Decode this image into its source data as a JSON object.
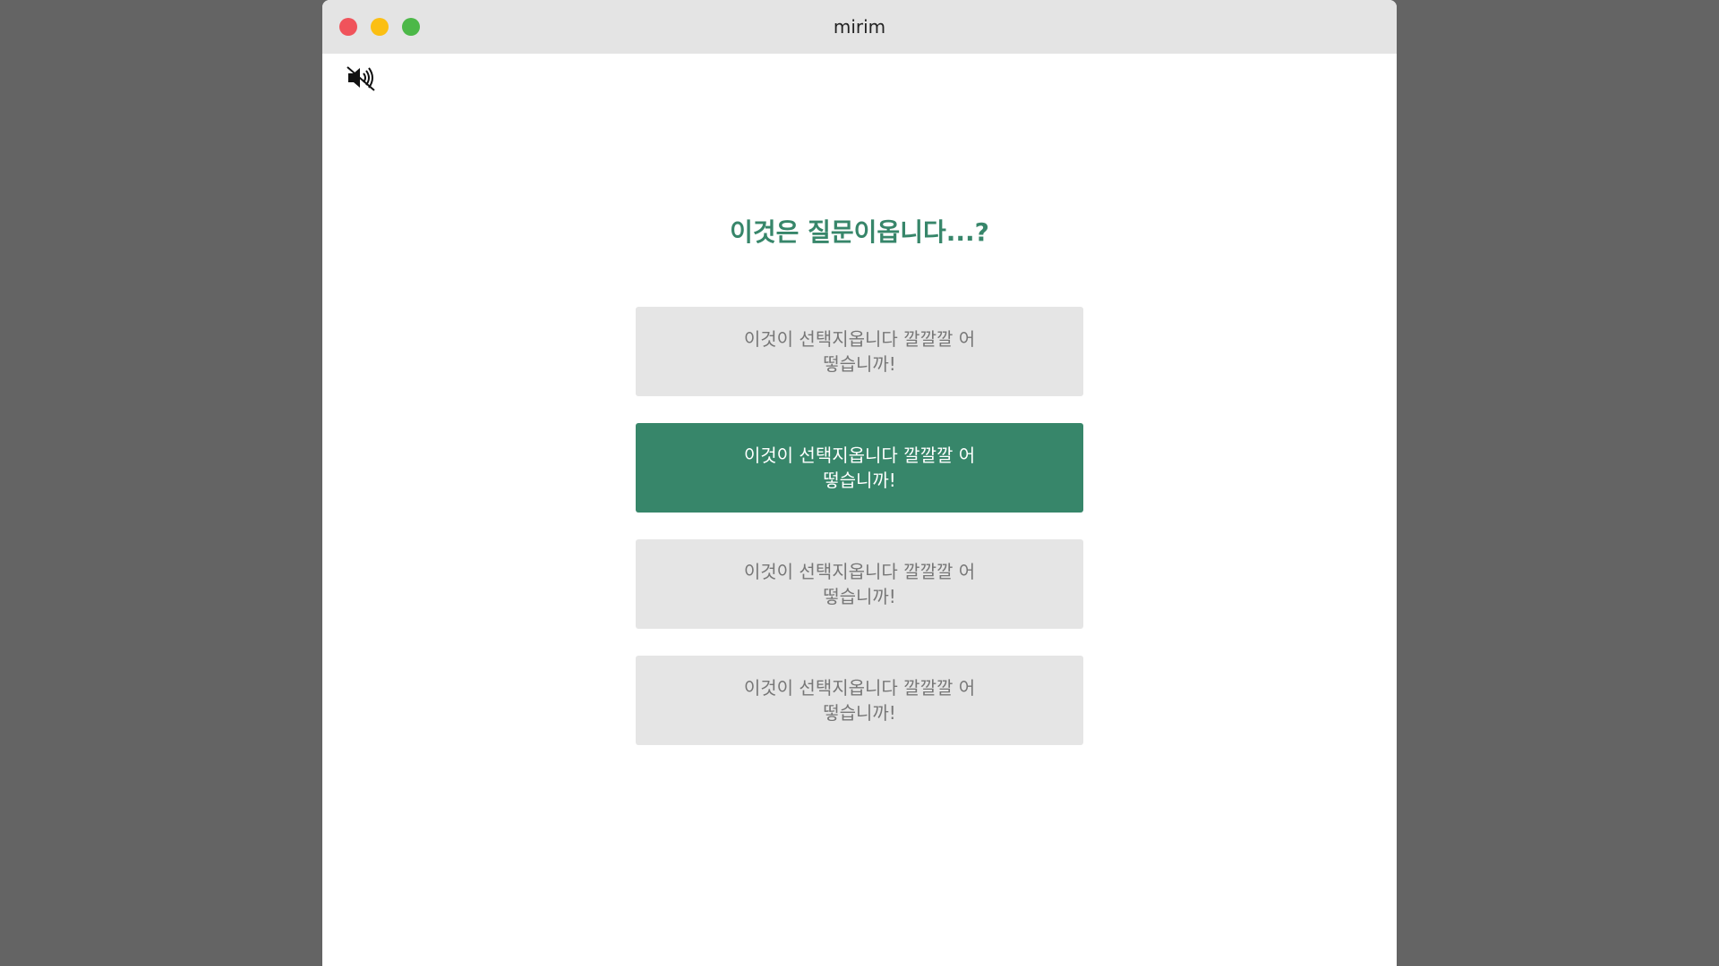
{
  "window": {
    "title": "mirim"
  },
  "toolbar": {
    "mute_icon": "speaker-muted-icon"
  },
  "quiz": {
    "question": "이것은 질문이옵니다...?",
    "choices": [
      {
        "label": "이것이 선택지옵니다 깔깔깔 어떻습니까!",
        "selected": false
      },
      {
        "label": "이것이 선택지옵니다 깔깔깔 어떻습니까!",
        "selected": true
      },
      {
        "label": "이것이 선택지옵니다 깔깔깔 어떻습니까!",
        "selected": false
      },
      {
        "label": "이것이 선택지옵니다 깔깔깔 어떻습니까!",
        "selected": false
      }
    ]
  },
  "colors": {
    "accent": "#37866a",
    "choice_bg": "#e5e5e5",
    "choice_text": "#777777",
    "background": "#646464",
    "titlebar": "#e4e4e4"
  }
}
